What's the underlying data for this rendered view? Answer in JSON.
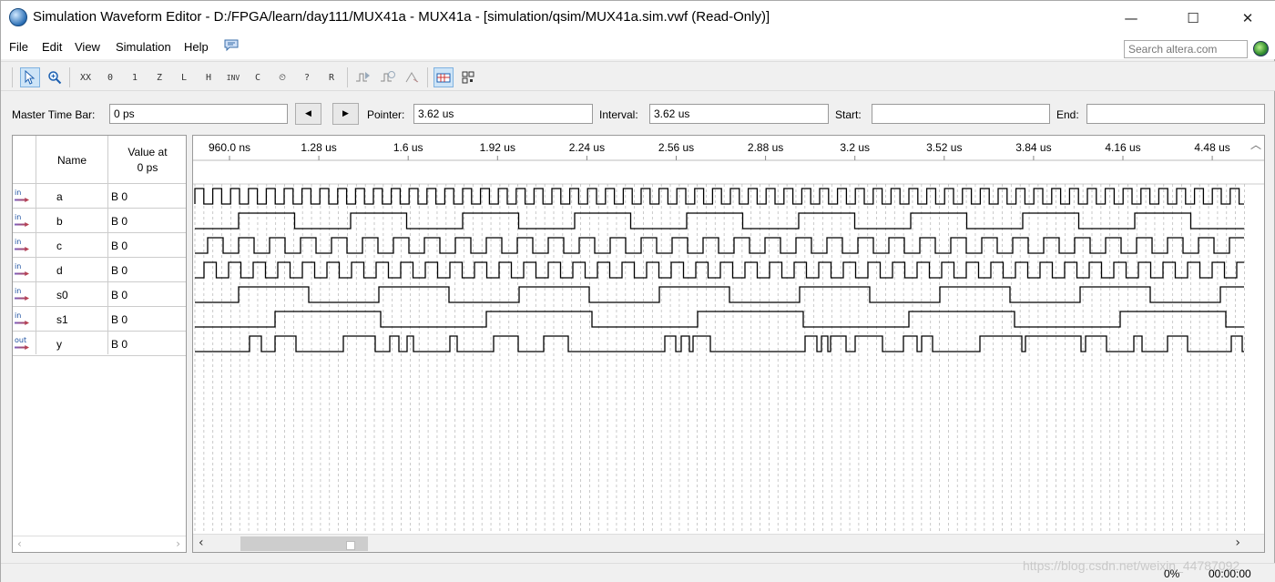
{
  "window": {
    "title": "Simulation Waveform Editor - D:/FPGA/learn/day111/MUX41a - MUX41a - [simulation/qsim/MUX41a.sim.vwf (Read-Only)]",
    "minimize": "—",
    "maximize": "☐",
    "close": "✕"
  },
  "menu": {
    "file": "File",
    "edit": "Edit",
    "view": "View",
    "simulation": "Simulation",
    "help": "Help"
  },
  "search": {
    "placeholder": "Search altera.com"
  },
  "toolbar": {
    "buttons": [
      "select-tool",
      "zoom-tool",
      "forcing-unknown",
      "forcing-low",
      "forcing-high",
      "high-impedance",
      "weak-low",
      "weak-high",
      "invert",
      "count-value",
      "clock",
      "random",
      "weak-unknown",
      "run-functional",
      "run-timing",
      "timing-netlist",
      "snap-to-grid",
      "grid-settings"
    ],
    "labels": {
      "unk": "XX",
      "low": "0",
      "high": "1",
      "z": "Z",
      "wl": "L",
      "wh": "H",
      "inv": "INV",
      "cnt": "C",
      "clk": "⏲",
      "rnd": "?",
      "wu": "R"
    }
  },
  "timebar": {
    "master_label": "Master Time Bar:",
    "master_value": "0 ps",
    "prev": "◀",
    "next": "▶",
    "pointer_label": "Pointer:",
    "pointer_value": "3.62 us",
    "interval_label": "Interval:",
    "interval_value": "3.62 us",
    "start_label": "Start:",
    "start_value": "",
    "end_label": "End:",
    "end_value": ""
  },
  "names_panel": {
    "col_name": "Name",
    "col_value_line1": "Value at",
    "col_value_line2": "0 ps",
    "signals": [
      {
        "dir": "in",
        "name": "a",
        "value": "B 0"
      },
      {
        "dir": "in",
        "name": "b",
        "value": "B 0"
      },
      {
        "dir": "in",
        "name": "c",
        "value": "B 0"
      },
      {
        "dir": "in",
        "name": "d",
        "value": "B 0"
      },
      {
        "dir": "in",
        "name": "s0",
        "value": "B 0"
      },
      {
        "dir": "in",
        "name": "s1",
        "value": "B 0"
      },
      {
        "dir": "out",
        "name": "y",
        "value": "B 0"
      }
    ]
  },
  "wave_panel": {
    "time_ticks": [
      "960.0 ns",
      "1.28 us",
      "1.6 us",
      "1.92 us",
      "2.24 us",
      "2.56 us",
      "2.88 us",
      "3.2 us",
      "3.52 us",
      "3.84 us",
      "4.16 us",
      "4.48 us"
    ]
  },
  "status": {
    "percent": "0%",
    "elapsed": "00:00:00",
    "watermark": "https://blog.csdn.net/weixin_44787092"
  }
}
